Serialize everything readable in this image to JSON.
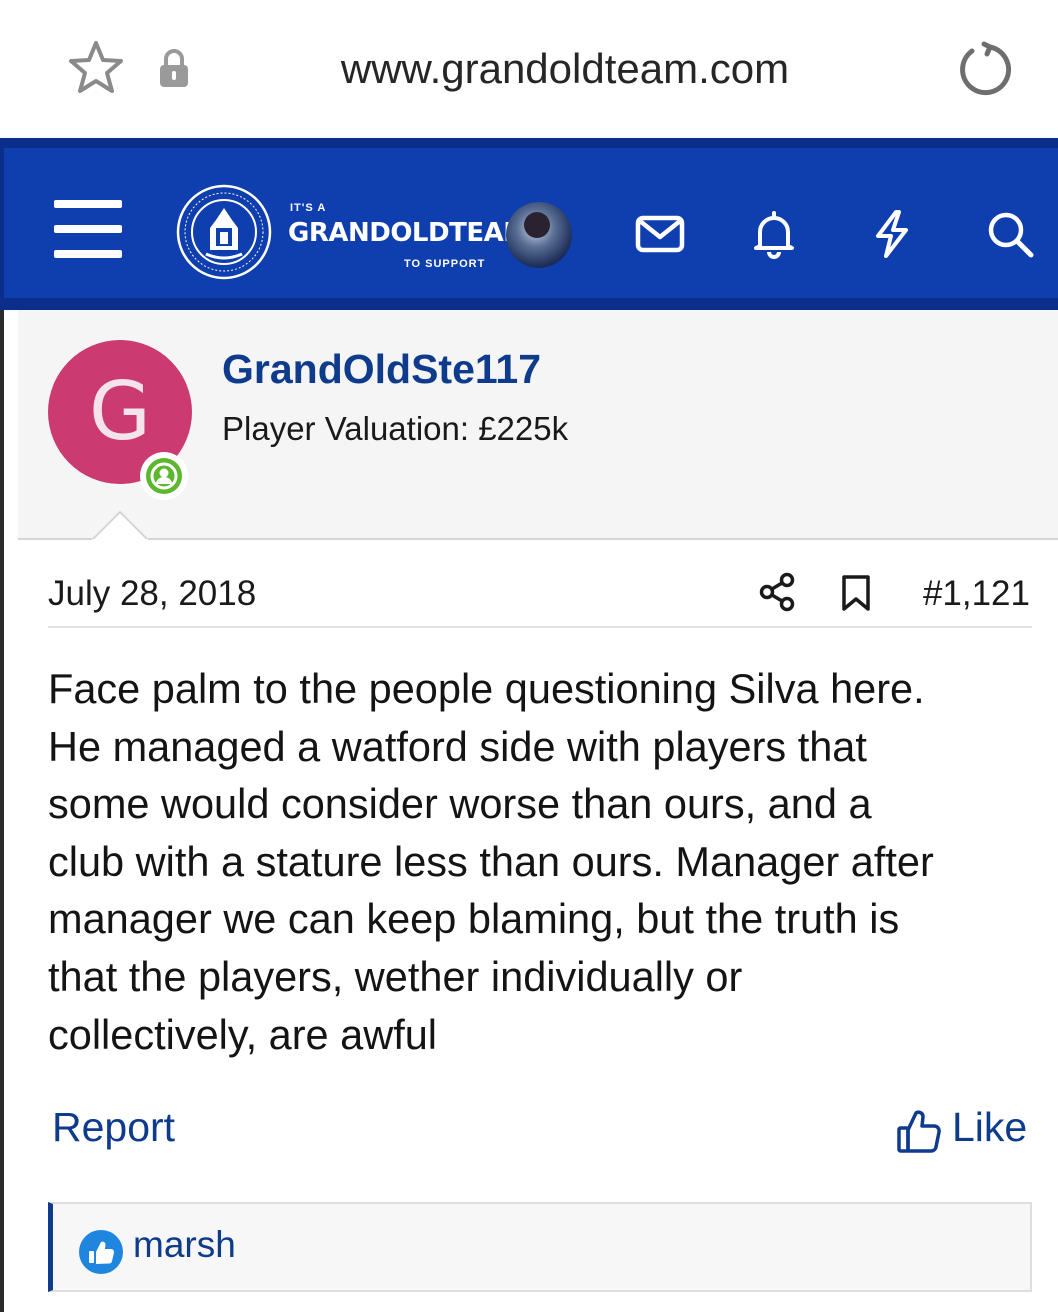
{
  "browser": {
    "url": "www.grandoldteam.com"
  },
  "header": {
    "brand_top": "IT'S A",
    "brand_main": "GRANDOLDTEAM",
    "brand_bottom": "TO SUPPORT",
    "icons": [
      "menu-icon",
      "envelope-icon",
      "bell-icon",
      "bolt-icon",
      "search-icon"
    ],
    "color": "#0f3fae"
  },
  "post": {
    "avatar_letter": "G",
    "avatar_color": "#cc3a72",
    "username": "GrandOldSte117",
    "user_title": "Player Valuation: £225k",
    "date": "July 28, 2018",
    "post_number": "#1,121",
    "body": "Face palm to the people questioning Silva here.\nHe managed a watford side with players that\nsome would consider worse than ours, and a\nclub with a stature less than ours. Manager after\nmanager we can keep blaming, but the truth is\nthat the players, wether individually or\ncollectively, are awful",
    "report_label": "Report",
    "like_label": "Like",
    "reactions": {
      "users": [
        "marsh"
      ]
    }
  },
  "colors": {
    "link": "#0f3b8c",
    "online": "#5cb72c"
  }
}
